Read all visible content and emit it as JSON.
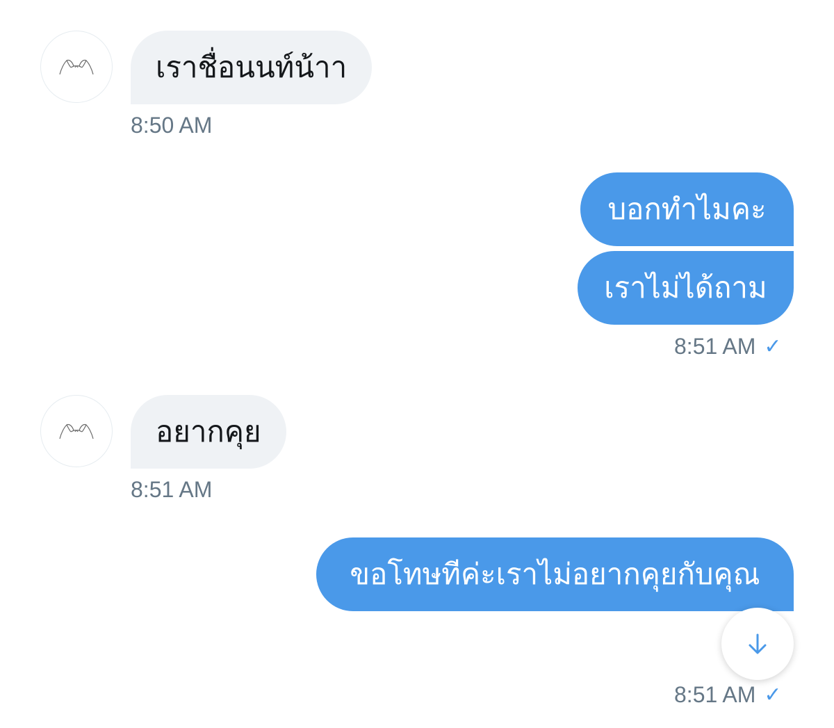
{
  "messages": [
    {
      "direction": "in",
      "text": "เราชื่อนนท์น้าา",
      "time": "8:50 AM"
    },
    {
      "direction": "out",
      "text": "บอกทำไมคะ"
    },
    {
      "direction": "out",
      "text": "เราไม่ได้ถาม",
      "time": "8:51 AM",
      "status": "check-icon"
    },
    {
      "direction": "in",
      "text": "อยากคุย",
      "time": "8:51 AM"
    },
    {
      "direction": "out",
      "text": "ขอโทษทีค่ะเราไม่อยากคุยกับคุณ",
      "time": "8:51 AM",
      "status": "check-icon"
    }
  ],
  "check_glyph": "✓",
  "scroll_button_icon": "arrow-down-icon",
  "colors": {
    "outgoing_bubble": "#4a99e9",
    "incoming_bubble": "#eff2f5",
    "timestamp": "#657786"
  }
}
